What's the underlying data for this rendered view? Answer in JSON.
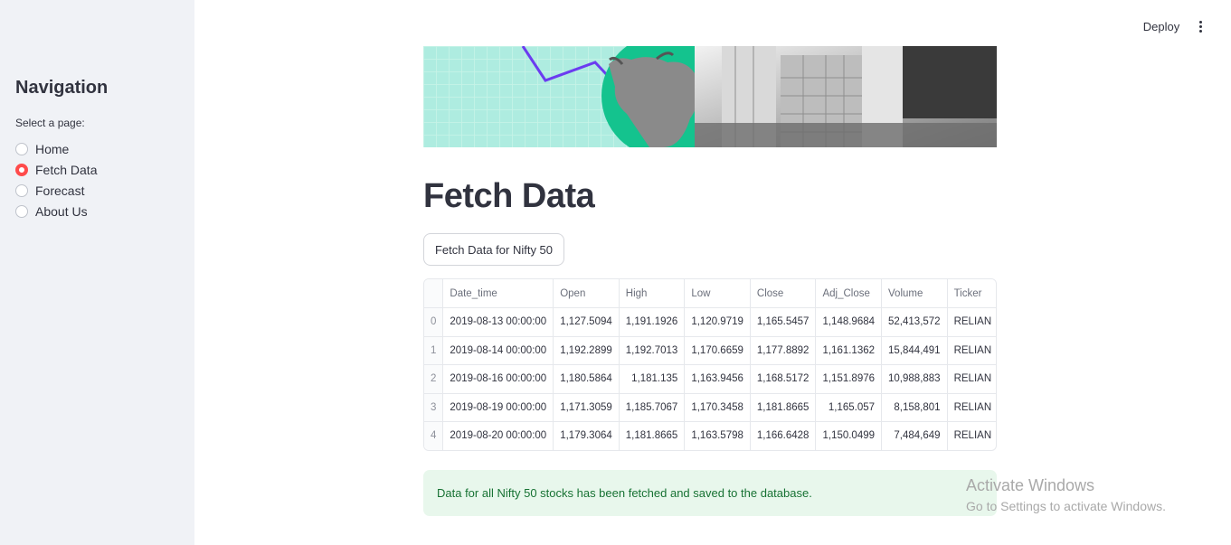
{
  "sidebar": {
    "title": "Navigation",
    "select_label": "Select a page:",
    "options": [
      "Home",
      "Fetch Data",
      "Forecast",
      "About Us"
    ],
    "selected": "Fetch Data"
  },
  "topbar": {
    "deploy_label": "Deploy",
    "menu_icon": "vertical-ellipsis-icon"
  },
  "main": {
    "title": "Fetch Data",
    "fetch_button_label": "Fetch Data for Nifty 50",
    "table": {
      "columns": [
        "",
        "Date_time",
        "Open",
        "High",
        "Low",
        "Close",
        "Adj_Close",
        "Volume",
        "Ticker"
      ],
      "rows": [
        [
          "0",
          "2019-08-13 00:00:00",
          "1,127.5094",
          "1,191.1926",
          "1,120.9719",
          "1,165.5457",
          "1,148.9684",
          "52,413,572",
          "RELIAN"
        ],
        [
          "1",
          "2019-08-14 00:00:00",
          "1,192.2899",
          "1,192.7013",
          "1,170.6659",
          "1,177.8892",
          "1,161.1362",
          "15,844,491",
          "RELIAN"
        ],
        [
          "2",
          "2019-08-16 00:00:00",
          "1,180.5864",
          "1,181.135",
          "1,163.9456",
          "1,168.5172",
          "1,151.8976",
          "10,988,883",
          "RELIAN"
        ],
        [
          "3",
          "2019-08-19 00:00:00",
          "1,171.3059",
          "1,185.7067",
          "1,170.3458",
          "1,181.8665",
          "1,165.057",
          "8,158,801",
          "RELIAN"
        ],
        [
          "4",
          "2019-08-20 00:00:00",
          "1,179.3064",
          "1,181.8665",
          "1,163.5798",
          "1,166.6428",
          "1,150.0499",
          "7,484,649",
          "RELIAN"
        ]
      ]
    },
    "success_message": "Data for all Nifty 50 stocks has been fetched and saved to the database."
  },
  "watermark": {
    "line1": "Activate Windows",
    "line2": "Go to Settings to activate Windows."
  },
  "colors": {
    "accent": "#ff4b4b",
    "sidebar_bg": "#f0f2f6",
    "success_bg": "#e8f7ec",
    "success_text": "#177233"
  }
}
